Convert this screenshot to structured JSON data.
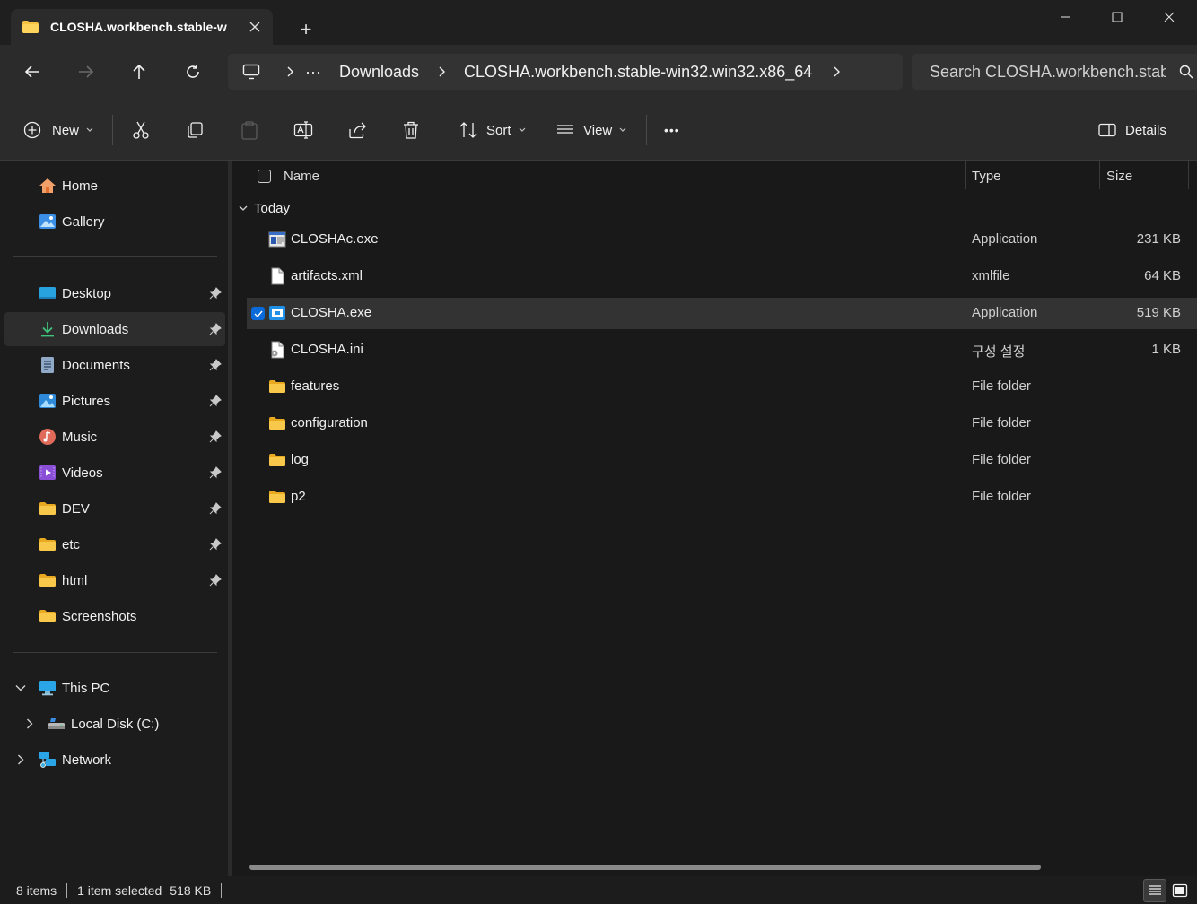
{
  "window": {
    "tab_title": "CLOSHA.workbench.stable-w",
    "new_tab_symbol": "+"
  },
  "address": {
    "ellipsis": "···",
    "segments": [
      "Downloads",
      "CLOSHA.workbench.stable-win32.win32.x86_64"
    ],
    "search_placeholder": "Search CLOSHA.workbench.stab"
  },
  "toolbar": {
    "new_label": "New",
    "sort_label": "Sort",
    "view_label": "View",
    "more_label": "•••",
    "details_label": "Details"
  },
  "sidebar": {
    "top_items": [
      {
        "label": "Home",
        "icon": "home-icon"
      },
      {
        "label": "Gallery",
        "icon": "gallery-icon"
      }
    ],
    "pinned_items": [
      {
        "label": "Desktop",
        "icon": "desktop-icon"
      },
      {
        "label": "Downloads",
        "icon": "downloads-icon"
      },
      {
        "label": "Documents",
        "icon": "documents-icon"
      },
      {
        "label": "Pictures",
        "icon": "pictures-icon"
      },
      {
        "label": "Music",
        "icon": "music-icon"
      },
      {
        "label": "Videos",
        "icon": "videos-icon"
      },
      {
        "label": "DEV",
        "icon": "folder-icon"
      },
      {
        "label": "etc",
        "icon": "folder-icon"
      },
      {
        "label": "html",
        "icon": "folder-icon"
      },
      {
        "label": "Screenshots",
        "icon": "folder-icon"
      }
    ],
    "selected": "Downloads",
    "tree_items": [
      {
        "label": "This PC",
        "icon": "this-pc-icon"
      },
      {
        "label": "Local Disk (C:)",
        "icon": "local-disk-icon"
      },
      {
        "label": "Network",
        "icon": "network-icon"
      }
    ]
  },
  "list": {
    "columns": {
      "name": "Name",
      "type": "Type",
      "size": "Size"
    },
    "group_label": "Today",
    "files": [
      {
        "name": "CLOSHAc.exe",
        "type": "Application",
        "size": "231 KB",
        "icon": "console-app-icon"
      },
      {
        "name": "artifacts.xml",
        "type": "xmlfile",
        "size": "64 KB",
        "icon": "file-icon"
      },
      {
        "name": "CLOSHA.exe",
        "type": "Application",
        "size": "519 KB",
        "icon": "closha-app-icon"
      },
      {
        "name": "CLOSHA.ini",
        "type": "구성 설정",
        "size": "1 KB",
        "icon": "config-file-icon"
      },
      {
        "name": "features",
        "type": "File folder",
        "size": "",
        "icon": "folder-icon"
      },
      {
        "name": "configuration",
        "type": "File folder",
        "size": "",
        "icon": "folder-icon"
      },
      {
        "name": "log",
        "type": "File folder",
        "size": "",
        "icon": "folder-icon"
      },
      {
        "name": "p2",
        "type": "File folder",
        "size": "",
        "icon": "folder-icon"
      }
    ],
    "selected_index": 2
  },
  "status": {
    "item_count": "8 items",
    "selection": "1 item selected",
    "selection_size": "518 KB"
  },
  "colors": {
    "folder": "#f5c242",
    "accent": "#0a6ad9"
  }
}
